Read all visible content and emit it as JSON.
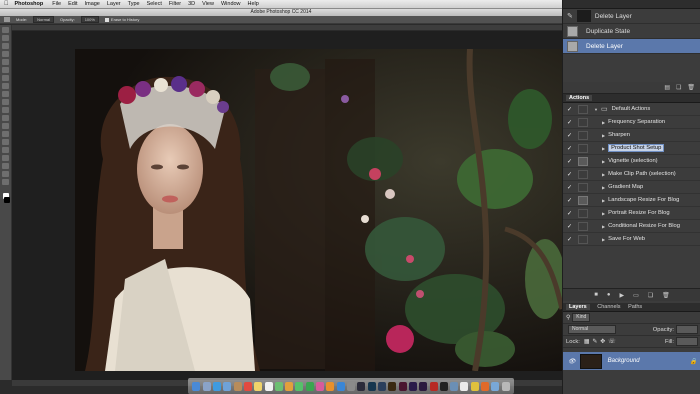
{
  "menubar": {
    "apple": "",
    "app": "Photoshop",
    "items": [
      "File",
      "Edit",
      "Image",
      "Layer",
      "Type",
      "Select",
      "Filter",
      "3D",
      "View",
      "Window",
      "Help"
    ],
    "right_status": ""
  },
  "window": {
    "title": "Adobe Photoshop CC 2014"
  },
  "optionsbar": {
    "mode_label": "Mode:",
    "mode_value": "Normal",
    "opacity_label": "Opacity:",
    "opacity_value": "100%",
    "erase_label": "Erase to History",
    "flow_label": "Flow:",
    "flow_value": "100%"
  },
  "doc_tab": "",
  "status": "",
  "history": {
    "header": "",
    "items": [
      {
        "label": "Delete Layer",
        "type": "snapshot"
      },
      {
        "label": "Duplicate State",
        "type": "state"
      },
      {
        "label": "Delete Layer",
        "type": "state",
        "selected": true
      }
    ]
  },
  "actions": {
    "header": "Actions",
    "set_label": "Default Actions",
    "items": [
      {
        "label": "Frequency Separation",
        "dialog": false
      },
      {
        "label": "Sharpen",
        "dialog": false
      },
      {
        "label": "Product Shot Setup",
        "dialog": false,
        "selected": true
      },
      {
        "label": "Vignette (selection)",
        "dialog": true
      },
      {
        "label": "Make Clip Path (selection)",
        "dialog": false
      },
      {
        "label": "Gradient Map",
        "dialog": false
      },
      {
        "label": "Landscape Resize For Blog",
        "dialog": true
      },
      {
        "label": "Portrait Resize For Blog",
        "dialog": false
      },
      {
        "label": "Conditional Resize For Blog",
        "dialog": false
      },
      {
        "label": "Save For Web",
        "dialog": false
      }
    ]
  },
  "layers": {
    "tabs": [
      "Layers",
      "Channels",
      "Paths"
    ],
    "kind_label": "Kind",
    "blend_mode": "Normal",
    "opacity_label": "Opacity:",
    "lock_label": "Lock:",
    "fill_label": "Fill:",
    "background_layer": "Background"
  }
}
